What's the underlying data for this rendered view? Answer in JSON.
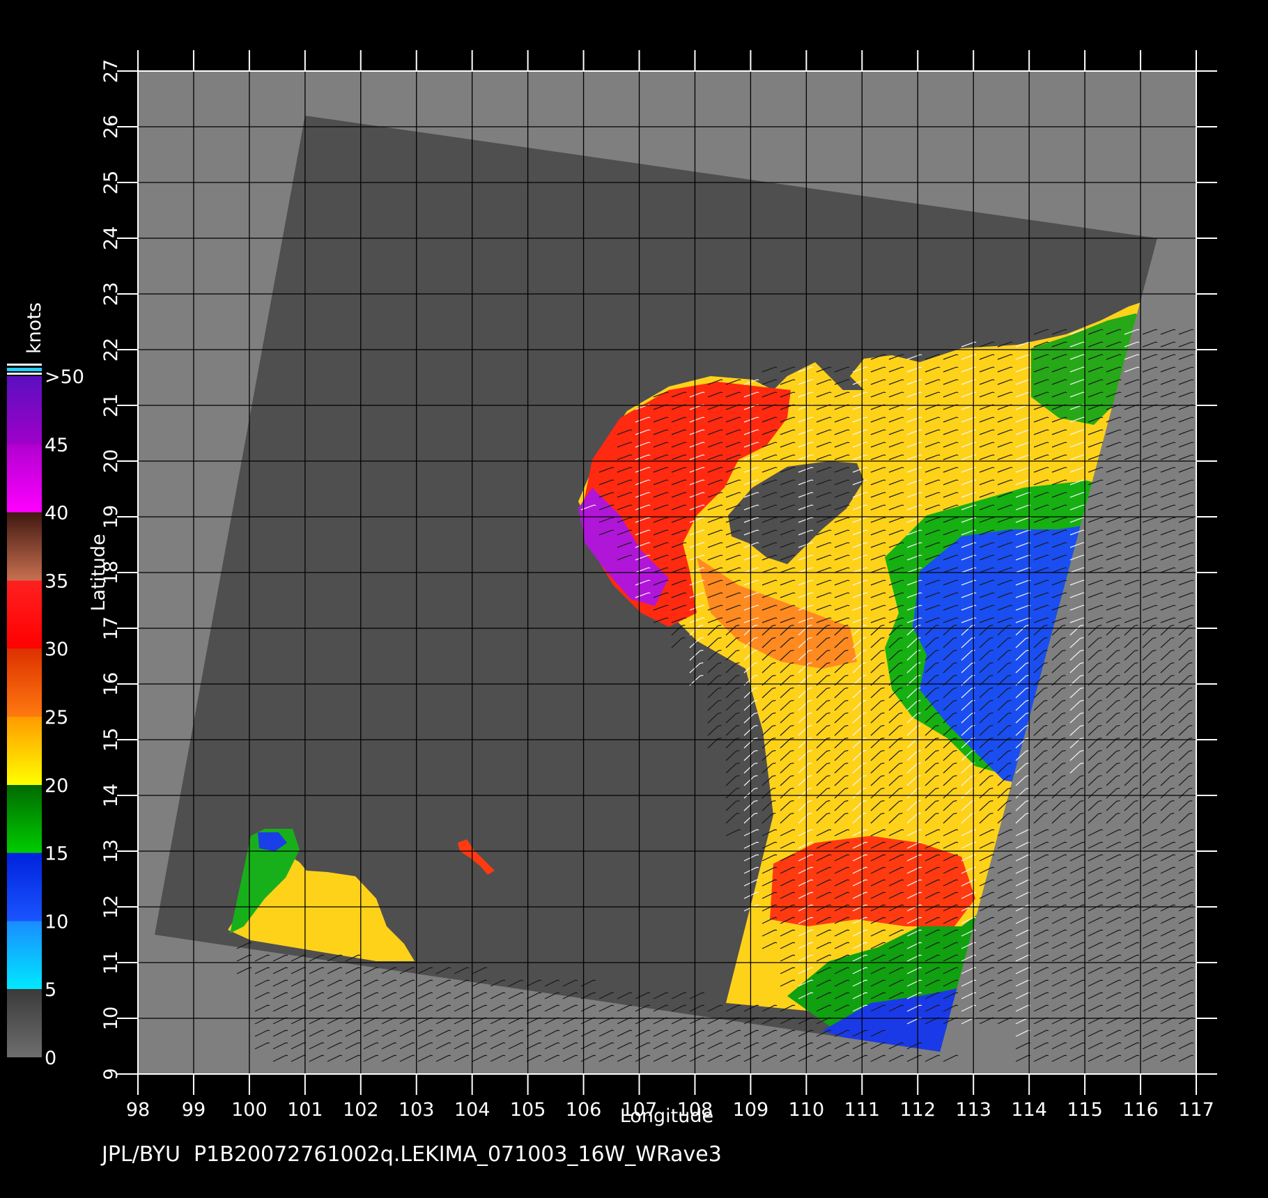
{
  "map": {
    "xlabel": "Longitude",
    "ylabel": "Latitude",
    "x_ticks": [
      98,
      99,
      100,
      101,
      102,
      103,
      104,
      105,
      106,
      107,
      108,
      109,
      110,
      111,
      112,
      113,
      114,
      115,
      116,
      117
    ],
    "y_ticks": [
      9,
      10,
      11,
      12,
      13,
      14,
      15,
      16,
      17,
      18,
      19,
      20,
      21,
      22,
      23,
      24,
      25,
      26,
      27
    ],
    "xlim": [
      98,
      117
    ],
    "ylim": [
      9,
      27
    ],
    "grid": true
  },
  "colorbar": {
    "unit": "knots",
    "labels": [
      "0",
      "5",
      "10",
      "15",
      "20",
      "25",
      "30",
      "35",
      "40",
      "45",
      ">50"
    ],
    "stops": [
      0,
      5,
      10,
      15,
      20,
      25,
      30,
      35,
      40,
      45,
      50
    ],
    "segment_colors": [
      "#777777",
      "#22ddff",
      "#1144ee",
      "#00aa00",
      "#ffd000",
      "#ff5010",
      "#ff1010",
      "#b06040",
      "#ff00ff",
      "#8a10d0"
    ]
  },
  "colors": {
    "background": "#000000",
    "land": "#7f7f7f",
    "swath": "#4f4f4f",
    "grid": "#000000"
  },
  "footer": {
    "text": "JPL/BYU  P1B20072761002q.LEKIMA_071003_16W_WRave3"
  }
}
